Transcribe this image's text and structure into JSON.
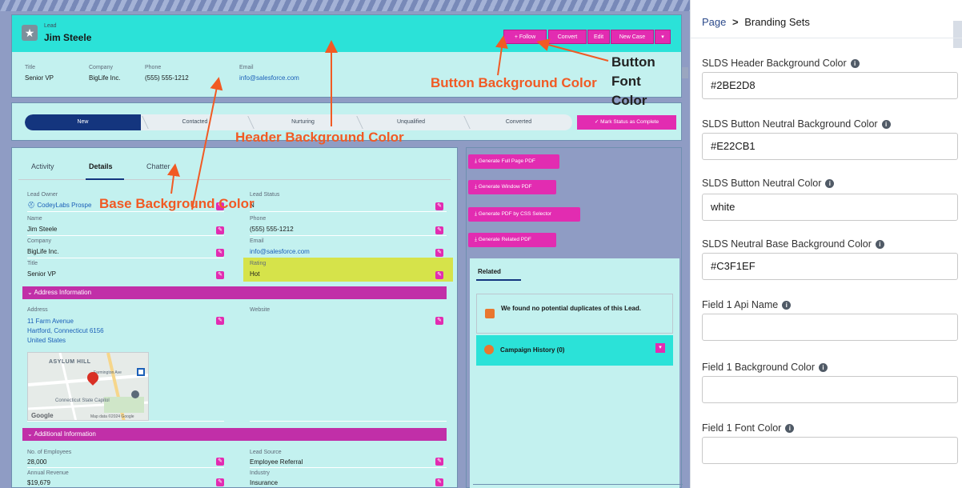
{
  "record": {
    "type_label": "Lead",
    "name": "Jim Steele",
    "buttons": {
      "follow": "+ Follow",
      "convert": "Convert",
      "edit": "Edit",
      "new_case": "New Case"
    },
    "highlights": [
      {
        "label": "Title",
        "value": "Senior VP"
      },
      {
        "label": "Company",
        "value": "BigLife Inc."
      },
      {
        "label": "Phone",
        "value": "(555) 555-1212"
      },
      {
        "label": "Email",
        "value": "info@salesforce.com"
      }
    ]
  },
  "path": {
    "steps": [
      "New",
      "Contacted",
      "Nurturing",
      "Unqualified",
      "Converted"
    ],
    "mark_complete": "✓  Mark Status as Complete"
  },
  "tabs": [
    "Activity",
    "Details",
    "Chatter"
  ],
  "details": {
    "lead_owner": {
      "label": "Lead Owner",
      "value": "CodeyLabs Prospe"
    },
    "lead_status": {
      "label": "Lead Status",
      "value": "N"
    },
    "name": {
      "label": "Name",
      "value": "Jim Steele"
    },
    "phone": {
      "label": "Phone",
      "value": "(555) 555-1212"
    },
    "company": {
      "label": "Company",
      "value": "BigLife Inc."
    },
    "email": {
      "label": "Email",
      "value": "info@salesforce.com"
    },
    "title": {
      "label": "Title",
      "value": "Senior VP"
    },
    "rating": {
      "label": "Rating",
      "value": "Hot"
    },
    "address_section": "Address Information",
    "address": {
      "label": "Address",
      "line1": "11 Farm Avenue",
      "line2": "Hartford, Connecticut 6156",
      "line3": "United States"
    },
    "website": {
      "label": "Website"
    },
    "map": {
      "place1": "ASYLUM HILL",
      "place2": "Farmington Ave",
      "place3": "Connecticut State Capitol",
      "credit": "Map data ©2024 Google",
      "logo": "Google"
    },
    "additional_section": "Additional Information",
    "employees": {
      "label": "No. of Employees",
      "value": "28,000"
    },
    "lead_source": {
      "label": "Lead Source",
      "value": "Employee Referral"
    },
    "revenue": {
      "label": "Annual Revenue",
      "value": "$19,679"
    },
    "industry": {
      "label": "Industry",
      "value": "Insurance"
    }
  },
  "pdf_buttons": [
    "Generate Full Page PDF",
    "Generate Window PDF",
    "Generate PDF by CSS Selector",
    "Generate Related PDF"
  ],
  "related": {
    "tab": "Related",
    "duplicates": "We found no potential duplicates of this Lead.",
    "campaign": "Campaign History (0)"
  },
  "annotations": {
    "button_bg": "Button Background Color",
    "button_font": "Button Font Color",
    "header_bg": "Header Background Color",
    "base_bg": "Base Background Color"
  },
  "property_panel": {
    "breadcrumb_parent": "Page",
    "breadcrumb_sep": ">",
    "breadcrumb_current": "Branding Sets",
    "fields": [
      {
        "label": "SLDS Header Background Color",
        "value": "#2BE2D8"
      },
      {
        "label": "SLDS Button Neutral Background Color",
        "value": "#E22CB1"
      },
      {
        "label": "SLDS Button Neutral Color",
        "value": "white"
      },
      {
        "label": "SLDS Neutral Base Background Color",
        "value": "#C3F1EF"
      },
      {
        "label": "Field 1 Api Name",
        "value": ""
      },
      {
        "label": "Field 1 Background Color",
        "value": ""
      },
      {
        "label": "Field 1 Font Color",
        "value": ""
      }
    ]
  },
  "colors": {
    "header_bg": "#2BE2D8",
    "button_bg": "#E22CB1",
    "base_bg": "#C3F1EF",
    "annotation": "#F15A24"
  }
}
